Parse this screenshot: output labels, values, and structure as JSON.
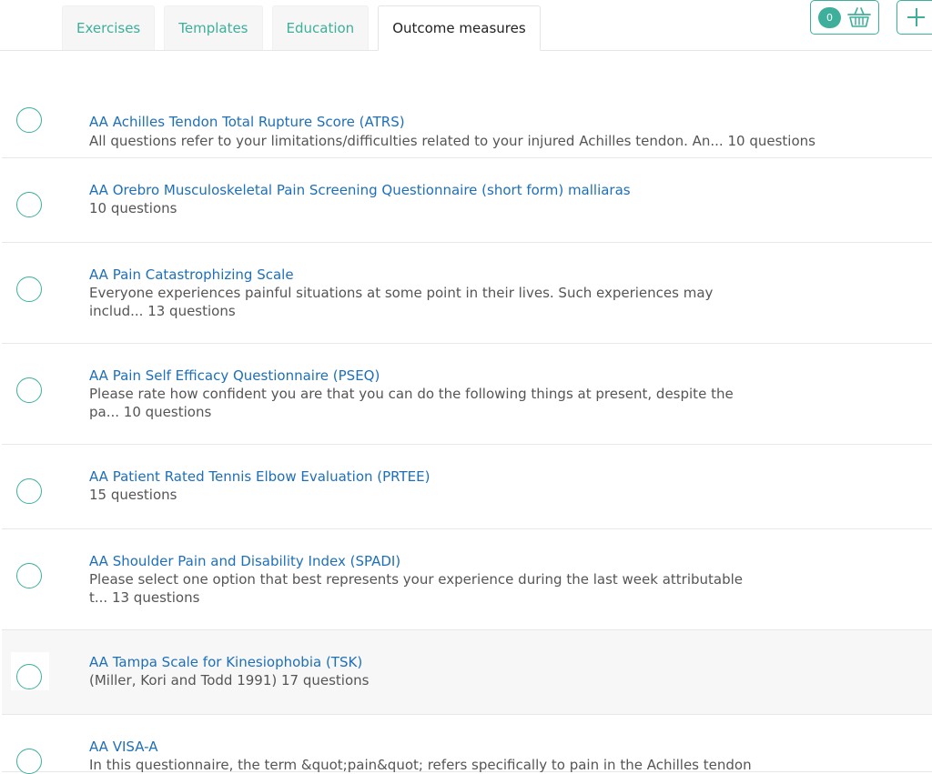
{
  "tabs": [
    {
      "label": "Exercises",
      "active": false
    },
    {
      "label": "Templates",
      "active": false
    },
    {
      "label": "Education",
      "active": false
    },
    {
      "label": "Outcome measures",
      "active": true
    }
  ],
  "basket": {
    "count": "0",
    "icon": "basket-icon"
  },
  "add": {
    "icon": "plus-icon"
  },
  "colors": {
    "accent": "#3eaf9b",
    "link": "#1e6fba",
    "text": "#555555"
  },
  "items": [
    {
      "title": "AA Achilles Tendon Total Rupture Score (ATRS)",
      "desc": "All questions refer to your limitations/difficulties related to your injured Achilles tendon. An... 10 questions"
    },
    {
      "title": "AA Orebro Musculoskeletal Pain Screening Questionnaire (short form) malliaras",
      "desc": " 10 questions"
    },
    {
      "title": "AA Pain Catastrophizing Scale",
      "desc": "Everyone experiences painful situations at some point in their lives. Such experiences may includ... 13 questions"
    },
    {
      "title": "AA Pain Self Efficacy Questionnaire (PSEQ)",
      "desc": "Please rate how confident you are that you can do the following things at present, despite the pa... 10 questions"
    },
    {
      "title": "AA Patient Rated Tennis Elbow Evaluation (PRTEE)",
      "desc": " 15 questions"
    },
    {
      "title": "AA Shoulder Pain and Disability Index (SPADI)",
      "desc": "Please select one option that best represents your experience during the last week attributable t... 13 questions"
    },
    {
      "title": "AA Tampa Scale for Kinesiophobia (TSK)",
      "desc": "(Miller, Kori and Todd 1991) 17 questions"
    },
    {
      "title": "AA VISA-A",
      "desc": "In this questionnaire, the term &quot;pain&quot; refers specifically to pain in the Achilles tendon"
    }
  ]
}
